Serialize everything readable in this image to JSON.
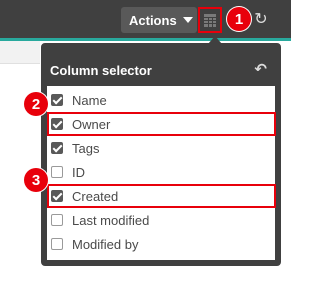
{
  "toolbar": {
    "actions_label": "Actions",
    "column_selector_icon": "grid-icon",
    "refresh_icon": "refresh-icon"
  },
  "popover": {
    "title": "Column selector",
    "back_icon": "back-arrow-icon",
    "options": [
      {
        "label": "Name",
        "checked": true
      },
      {
        "label": "Owner",
        "checked": true
      },
      {
        "label": "Tags",
        "checked": true
      },
      {
        "label": "ID",
        "checked": false
      },
      {
        "label": "Created",
        "checked": true
      },
      {
        "label": "Last modified",
        "checked": false
      },
      {
        "label": "Modified by",
        "checked": false
      }
    ]
  },
  "callouts": [
    "1",
    "2",
    "3"
  ],
  "colors": {
    "topbar": "#404040",
    "accent": "#28a99d",
    "highlight": "#e8000b"
  }
}
